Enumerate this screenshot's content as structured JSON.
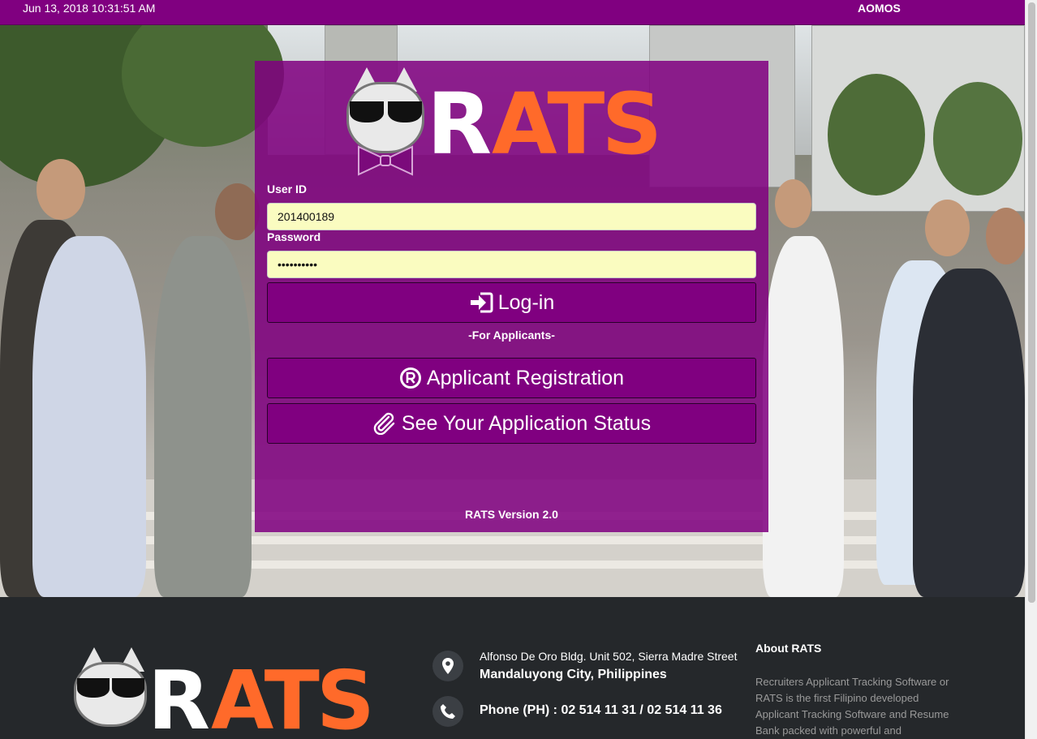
{
  "header": {
    "datetime": "Jun 13, 2018 10:31:51 AM",
    "username": "AOMOS"
  },
  "logo": {
    "letter_r": "R",
    "letters_ats": "ATS",
    "icon": "cat-with-sunglasses-icon"
  },
  "login": {
    "userid_label": "User ID",
    "userid_value": "201400189",
    "password_label": "Password",
    "password_value": "••••••••••",
    "login_button": "Log-in",
    "for_applicants": "-For Applicants-",
    "registration_button": "Applicant Registration",
    "status_button": "See Your Application Status",
    "version": "RATS Version 2.0"
  },
  "footer": {
    "address_line1": "Alfonso De Oro Bldg. Unit 502, Sierra Madre Street",
    "address_line2": "Mandaluyong City, Philippines",
    "phone": "Phone (PH) : 02 514 11 31 / 02 514 11 36",
    "about_title": "About RATS",
    "about_text": "Recruiters Applicant Tracking Software or RATS is the first Filipino developed Applicant Tracking Software and Resume Bank packed with powerful and"
  },
  "colors": {
    "brand_purple": "#800080",
    "logo_orange": "#ff6a2a",
    "input_bg": "#fafcc0",
    "footer_bg": "#25282b"
  }
}
